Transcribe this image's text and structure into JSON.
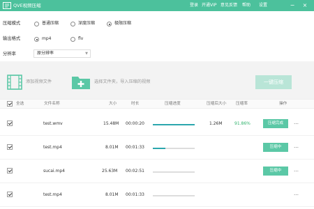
{
  "titlebar": {
    "app_title": "QVE视频压缩",
    "menu": [
      "登录",
      "开通VIP",
      "意见反馈",
      "帮助",
      "设置"
    ],
    "window_controls": [
      "minimize",
      "close"
    ]
  },
  "settings": {
    "compress_mode_label": "压缩模式",
    "compress_options": [
      "普通压缩",
      "深度压缩",
      "极限压缩"
    ],
    "compress_selected": "极限压缩",
    "output_format_label": "输出格式",
    "format_options": [
      "mp4",
      "flv"
    ],
    "format_selected": "mp4",
    "resolution_label": "分辨率",
    "resolution_value": "原分辨率"
  },
  "actions": {
    "add_file": "添加视频文件",
    "choose_folder": "选择文件夹，导入压缩的视频",
    "compress_button": "一键压缩"
  },
  "table": {
    "headers": [
      "全选",
      "文件名称",
      "大小",
      "时长",
      "压缩进度",
      "压缩后大小",
      "压缩率",
      "操作"
    ],
    "rows": [
      {
        "name": "test.wmv",
        "size": "15.48M",
        "duration": "00:00:20",
        "progress": 1.0,
        "after_size": "1.26M",
        "ratio": "91.86%",
        "status": "压缩完成",
        "more": "…"
      },
      {
        "name": "test.mp4",
        "size": "8.01M",
        "duration": "00:01:33",
        "progress": 0.3,
        "after_size": "",
        "ratio": "",
        "status": "压缩中",
        "more": "…"
      },
      {
        "name": "sucai.mp4",
        "size": "25.63M",
        "duration": "00:02:51",
        "progress": 0,
        "after_size": "",
        "ratio": "",
        "status": "压缩中",
        "more": "…"
      },
      {
        "name": "test.mp4",
        "size": "8.01M",
        "duration": "00:01:33",
        "progress": 0,
        "after_size": "",
        "ratio": "",
        "status": "",
        "more": "…"
      }
    ]
  },
  "colors": {
    "accent": "#4cc19c",
    "progress": "#2ba6ad",
    "button_disabled": "#b9e5d7",
    "ratio_green": "#31b36d"
  },
  "icons": [
    "app-logo-icon",
    "video-file-icon",
    "add-folder-icon",
    "chevron-down-icon",
    "minimize-icon",
    "close-icon"
  ]
}
